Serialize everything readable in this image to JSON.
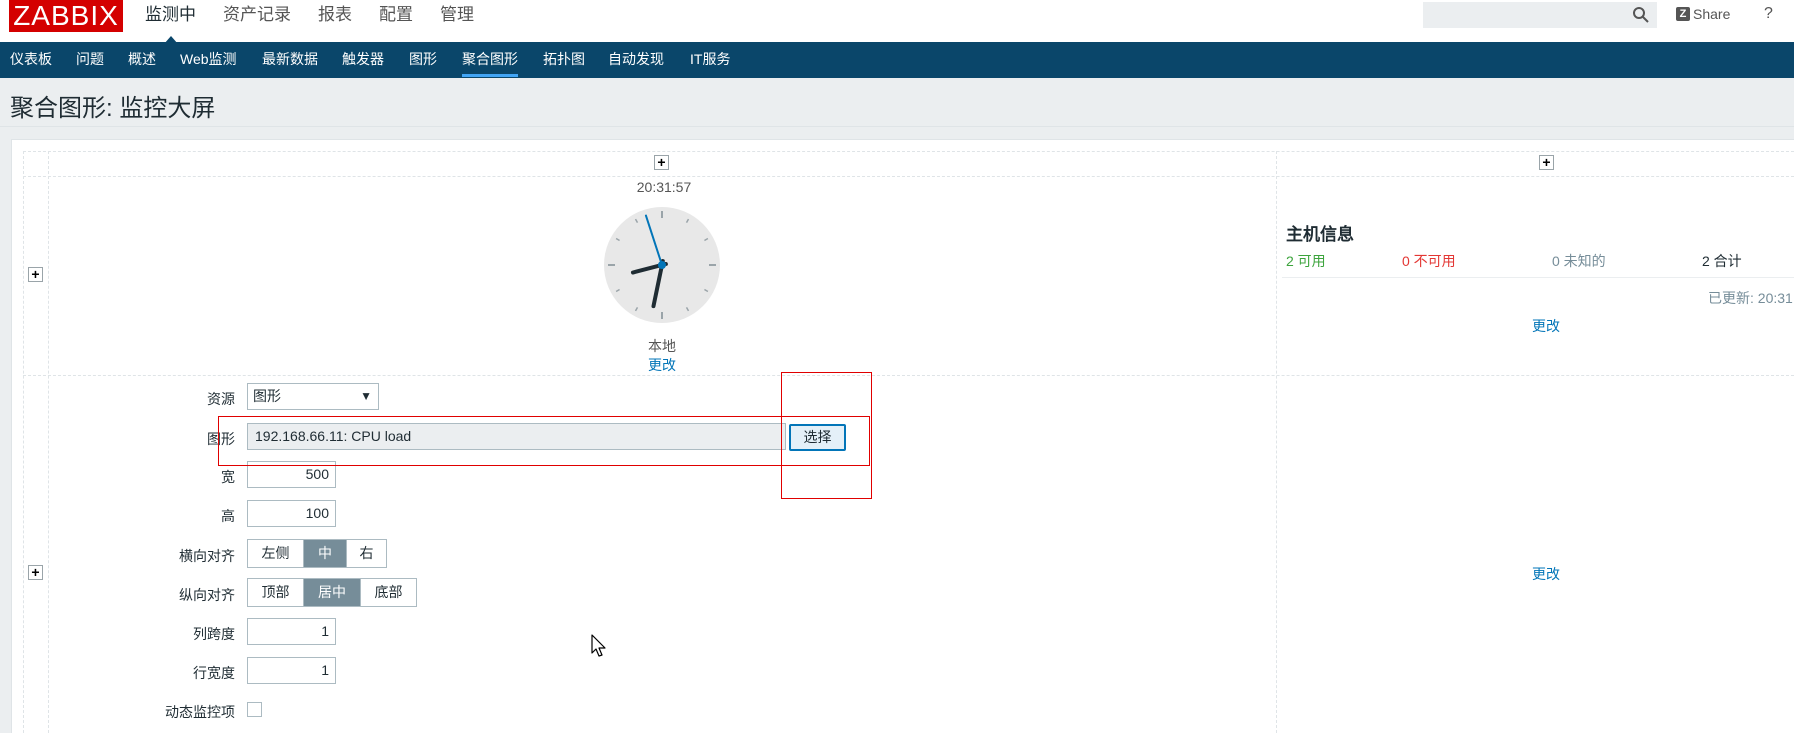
{
  "header": {
    "logo": "ZABBIX",
    "menu": [
      "监测中",
      "资产记录",
      "报表",
      "配置",
      "管理"
    ],
    "search_placeholder": "",
    "share_label": "Share",
    "help_label": "?"
  },
  "submenu": [
    "仪表板",
    "问题",
    "概述",
    "Web监测",
    "最新数据",
    "触发器",
    "图形",
    "聚合图形",
    "拓扑图",
    "自动发现",
    "IT服务"
  ],
  "page": {
    "title": "聚合图形: 监控大屏"
  },
  "clock": {
    "time": "20:31:57",
    "label": "本地",
    "change": "更改",
    "hours": 20,
    "minutes": 31,
    "seconds": 57
  },
  "host_info": {
    "title": "主机信息",
    "available": "2 可用",
    "unavailable": "0 不可用",
    "unknown": "0 未知的",
    "total": "2 合计",
    "updated": "已更新: 20:31",
    "change": "更改"
  },
  "cell_change": "更改",
  "form": {
    "resource_label": "资源",
    "resource_value": "图形",
    "graph_label": "图形",
    "graph_value": "192.168.66.11: CPU load",
    "select_button": "选择",
    "width_label": "宽",
    "width_value": "500",
    "height_label": "高",
    "height_value": "100",
    "halign_label": "横向对齐",
    "halign_options": [
      "左侧",
      "中",
      "右"
    ],
    "valign_label": "纵向对齐",
    "valign_options": [
      "顶部",
      "居中",
      "底部"
    ],
    "colspan_label": "列跨度",
    "colspan_value": "1",
    "rowspan_label": "行宽度",
    "rowspan_value": "1",
    "dynamic_label": "动态监控项"
  },
  "colors": {
    "brand": "#d40000",
    "nav": "#0a466a",
    "link": "#0275b8",
    "available": "#3da43d",
    "unavailable": "#e33734",
    "unknown": "#768d99"
  }
}
